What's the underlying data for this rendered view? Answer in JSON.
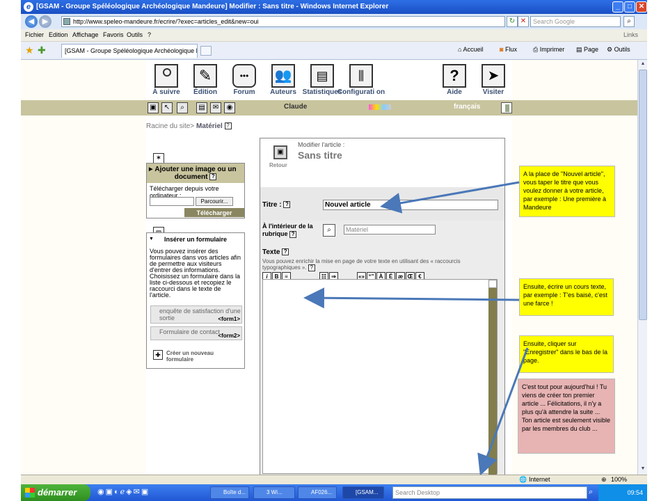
{
  "window": {
    "title": "[GSAM - Groupe Spéléologique Archéologique Mandeure] Modifier : Sans titre - Windows Internet Explorer"
  },
  "addressbar": {
    "url": "http://www.speleo-mandeure.fr/ecrire/?exec=articles_edit&new=oui",
    "search_placeholder": "Search Google"
  },
  "menu": {
    "items": [
      "Fichier",
      "Edition",
      "Affichage",
      "Favoris",
      "Outils",
      "?"
    ],
    "links": "Links"
  },
  "tabbar": {
    "tab_title": "[GSAM - Groupe Spéléologique Archéologique Mandeu...",
    "tools": [
      "Accueil",
      "Flux",
      "Imprimer",
      "Page",
      "Outils"
    ]
  },
  "nav": {
    "items": [
      "À suivre",
      "Édition",
      "Forum",
      "Auteurs",
      "Statistiques",
      "Configurati on",
      "Aide",
      "Visiter"
    ]
  },
  "subbar": {
    "user": "Claude",
    "lang": "français"
  },
  "breadcrumb": {
    "root": "Racine du site",
    "sep": ">",
    "current": "Matériel"
  },
  "upload": {
    "title": "Ajouter une image ou un document",
    "text": "Télécharger depuis votre ordinateur :",
    "browse": "Parcourir...",
    "submit": "Télécharger"
  },
  "forms": {
    "title": "Insérer un formulaire",
    "text": "Vous pouvez insérer des formulaires dans vos articles afin de permettre aux visiteurs d'entrer des informations. Choisissez un formulaire dans la liste ci-dessous et recopiez le raccourci dans le texte de l'article.",
    "items": [
      {
        "label": "enquête de satisfaction d'une sortie",
        "tag": "<form1>"
      },
      {
        "label": "Formulaire de contact",
        "tag": "<form2>"
      }
    ],
    "create": "Créer un nouveau formulaire"
  },
  "article": {
    "modify_label": "Modifier l'article :",
    "title": "Sans titre",
    "back": "Retour",
    "titre_label": "Titre :",
    "titre_value": "Nouvel article",
    "rubrique_label": "À l'intérieur de la rubrique",
    "rubrique_value": "Matériel",
    "texte_label": "Texte",
    "texte_hint": "Vous pouvez enrichir la mise en page de votre texte en utilisant des « raccourcis typographiques ».",
    "toolbar": [
      "i",
      "B",
      "≡",
      "«»",
      "“”",
      "À",
      "É",
      "æ",
      "Œ",
      "€"
    ]
  },
  "notes": [
    "A la place de \"Nouvel article\", vous taper le titre que vous voulez donner à votre article, par exemple : Une première à Mandeure",
    "Ensuite, écrire un cours texte, par exemple : T'es baisé, c'est une farce !",
    "Ensuite, cliquer sur \"Enregistrer\" dans le bas de la page.",
    "C'est tout pour aujourd'hui ! Tu viens de créer ton premier article ... Félicitations, il n'y a plus qu'à attendre la suite ... Ton article est seulement visible par les membres du club ..."
  ],
  "status": {
    "zone": "Internet",
    "zoom": "100%"
  },
  "taskbar": {
    "start": "démarrer",
    "tasks": [
      "Boîte d...",
      "3 Wi...",
      "AF026...",
      "[GSAM..."
    ],
    "search": "Search Desktop",
    "time": "09:54"
  },
  "colors": {
    "olive_bar": "#c8c49e",
    "note_yellow": "#ffff00",
    "note_pink": "#e7b3b3",
    "arrow": "#4a78b8"
  }
}
